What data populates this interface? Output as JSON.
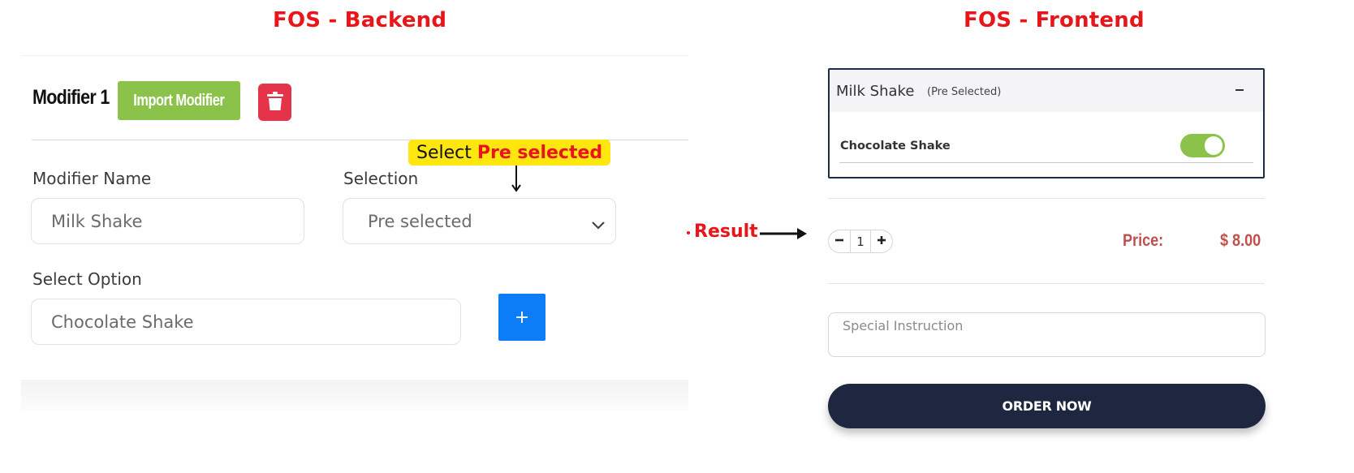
{
  "backend": {
    "heading": "FOS - Backend",
    "modifier_title": "Modifier 1",
    "import_label": "Import Modifier",
    "delete_icon": "trash-icon",
    "modifier_name_label": "Modifier Name",
    "modifier_name_value": "Milk Shake",
    "selection_label": "Selection",
    "selection_value": "Pre selected",
    "select_option_label": "Select Option",
    "select_option_value": "Chocolate Shake",
    "add_label": "+",
    "callout_text": "Select",
    "callout_emphasis": "Pre selected",
    "colors": {
      "import": "#8bc34a",
      "delete": "#e5344a",
      "add": "#0d7df7",
      "callout": "#ffe60f"
    }
  },
  "result_label": "Result",
  "frontend": {
    "heading": "FOS - Frontend",
    "item_title": "Milk Shake",
    "item_tag": "(Pre Selected)",
    "option_label": "Chocolate Shake",
    "option_toggle_on": true,
    "quantity": "1",
    "price_label": "Price:",
    "price_value": "$ 8.00",
    "instruction_placeholder": "Special Instruction",
    "order_label": "ORDER NOW",
    "colors": {
      "order_button": "#1e2640",
      "price": "#c0504d",
      "toggle": "#8bc34a"
    }
  }
}
